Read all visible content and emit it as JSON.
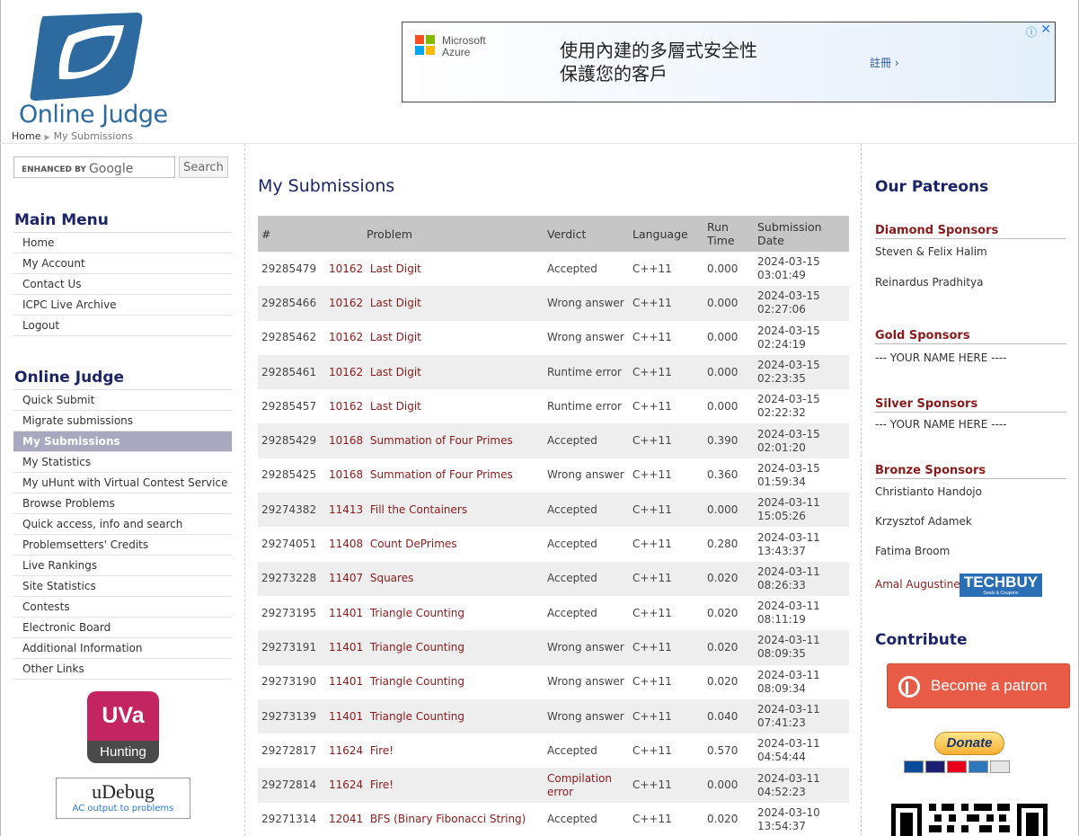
{
  "header": {
    "logo_text": "Online Judge",
    "breadcrumb": {
      "home": "Home",
      "current": "My Submissions"
    }
  },
  "ad": {
    "brand_line1": "Microsoft",
    "brand_line2": "Azure",
    "text": "使用內建的多層式安全性保護您的客戶",
    "cta": "註冊 ›",
    "info_icon": "info-icon",
    "close_icon": "close-icon"
  },
  "search": {
    "enhanced_by": "ENHANCED BY",
    "google": "Google",
    "button_label": "Search"
  },
  "main_menu": {
    "title": "Main Menu",
    "items": [
      "Home",
      "My Account",
      "Contact Us",
      "ICPC Live Archive",
      "Logout"
    ]
  },
  "online_judge_menu": {
    "title": "Online Judge",
    "items": [
      "Quick Submit",
      "Migrate submissions",
      "My Submissions",
      "My Statistics",
      "My uHunt with Virtual Contest Service",
      "Browse Problems",
      "Quick access, info and search",
      "Problemsetters' Credits",
      "Live Rankings",
      "Site Statistics",
      "Contests",
      "Electronic Board",
      "Additional Information",
      "Other Links"
    ],
    "active_index": 2
  },
  "badges": {
    "uva_top": "UVa",
    "uva_bottom": "Hunting",
    "udebug_name": "uDebug",
    "udebug_tag": "AC output to problems"
  },
  "main": {
    "title": "My Submissions",
    "columns": [
      "#",
      "Problem",
      "Verdict",
      "Language",
      "Run Time",
      "Submission Date"
    ],
    "rows": [
      {
        "id": "29285479",
        "pid": "10162",
        "pname": "Last Digit",
        "verdict": "Accepted",
        "lang": "C++11",
        "time": "0.000",
        "date": "2024-03-15",
        "clock": "03:01:49"
      },
      {
        "id": "29285466",
        "pid": "10162",
        "pname": "Last Digit",
        "verdict": "Wrong answer",
        "lang": "C++11",
        "time": "0.000",
        "date": "2024-03-15",
        "clock": "02:27:06"
      },
      {
        "id": "29285462",
        "pid": "10162",
        "pname": "Last Digit",
        "verdict": "Wrong answer",
        "lang": "C++11",
        "time": "0.000",
        "date": "2024-03-15",
        "clock": "02:24:19"
      },
      {
        "id": "29285461",
        "pid": "10162",
        "pname": "Last Digit",
        "verdict": "Runtime error",
        "lang": "C++11",
        "time": "0.000",
        "date": "2024-03-15",
        "clock": "02:23:35"
      },
      {
        "id": "29285457",
        "pid": "10162",
        "pname": "Last Digit",
        "verdict": "Runtime error",
        "lang": "C++11",
        "time": "0.000",
        "date": "2024-03-15",
        "clock": "02:22:32"
      },
      {
        "id": "29285429",
        "pid": "10168",
        "pname": "Summation of Four Primes",
        "verdict": "Accepted",
        "lang": "C++11",
        "time": "0.390",
        "date": "2024-03-15",
        "clock": "02:01:20"
      },
      {
        "id": "29285425",
        "pid": "10168",
        "pname": "Summation of Four Primes",
        "verdict": "Wrong answer",
        "lang": "C++11",
        "time": "0.360",
        "date": "2024-03-15",
        "clock": "01:59:34"
      },
      {
        "id": "29274382",
        "pid": "11413",
        "pname": "Fill the Containers",
        "verdict": "Accepted",
        "lang": "C++11",
        "time": "0.000",
        "date": "2024-03-11",
        "clock": "15:05:26"
      },
      {
        "id": "29274051",
        "pid": "11408",
        "pname": "Count DePrimes",
        "verdict": "Accepted",
        "lang": "C++11",
        "time": "0.280",
        "date": "2024-03-11",
        "clock": "13:43:37"
      },
      {
        "id": "29273228",
        "pid": "11407",
        "pname": "Squares",
        "verdict": "Accepted",
        "lang": "C++11",
        "time": "0.020",
        "date": "2024-03-11",
        "clock": "08:26:33"
      },
      {
        "id": "29273195",
        "pid": "11401",
        "pname": "Triangle Counting",
        "verdict": "Accepted",
        "lang": "C++11",
        "time": "0.020",
        "date": "2024-03-11",
        "clock": "08:11:19"
      },
      {
        "id": "29273191",
        "pid": "11401",
        "pname": "Triangle Counting",
        "verdict": "Wrong answer",
        "lang": "C++11",
        "time": "0.020",
        "date": "2024-03-11",
        "clock": "08:09:35"
      },
      {
        "id": "29273190",
        "pid": "11401",
        "pname": "Triangle Counting",
        "verdict": "Wrong answer",
        "lang": "C++11",
        "time": "0.020",
        "date": "2024-03-11",
        "clock": "08:09:34"
      },
      {
        "id": "29273139",
        "pid": "11401",
        "pname": "Triangle Counting",
        "verdict": "Wrong answer",
        "lang": "C++11",
        "time": "0.040",
        "date": "2024-03-11",
        "clock": "07:41:23"
      },
      {
        "id": "29272817",
        "pid": "11624",
        "pname": "Fire!",
        "verdict": "Accepted",
        "lang": "C++11",
        "time": "0.570",
        "date": "2024-03-11",
        "clock": "04:54:44"
      },
      {
        "id": "29272814",
        "pid": "11624",
        "pname": "Fire!",
        "verdict": "Compilation error",
        "lang": "C++11",
        "time": "0.000",
        "date": "2024-03-11",
        "clock": "04:52:23"
      },
      {
        "id": "29271314",
        "pid": "12041",
        "pname": "BFS (Binary Fibonacci String)",
        "verdict": "Accepted",
        "lang": "C++11",
        "time": "0.020",
        "date": "2024-03-10",
        "clock": "13:54:37"
      }
    ]
  },
  "right": {
    "patreons_title": "Our Patreons",
    "diamond_title": "Diamond Sponsors",
    "diamond": [
      "Steven & Felix Halim",
      "Reinardus Pradhitya"
    ],
    "gold_title": "Gold Sponsors",
    "gold": "--- YOUR NAME HERE ----",
    "silver_title": "Silver Sponsors",
    "silver": "--- YOUR NAME HERE ----",
    "bronze_title": "Bronze Sponsors",
    "bronze": [
      "Christianto Handojo",
      "Krzysztof Adamek",
      "Fatima Broom",
      "Amal Augustine"
    ],
    "techbuy": "TECHBUY",
    "techbuy_sub": "Deals & Coupons",
    "contribute_title": "Contribute",
    "patreon_button": "Become a patron",
    "donate_button": "Donate",
    "card_brands": [
      "Maestro",
      "VISA",
      "MasterCard",
      "American Express",
      "Cuenta bancaria"
    ]
  },
  "colors": {
    "menu_title": "#1b2466",
    "link": "#8b1a1a",
    "active_menu": "#a8a8c0",
    "table_header": "#c6c6c6",
    "patreon": "#e85b46"
  }
}
